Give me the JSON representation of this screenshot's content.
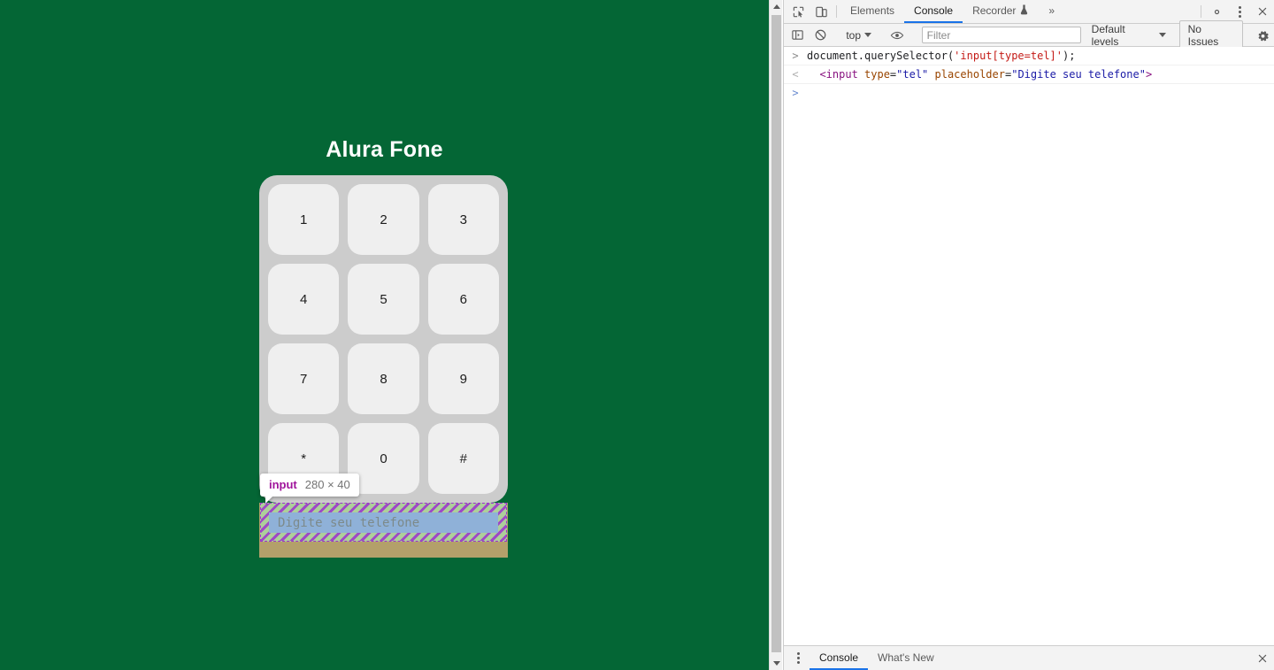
{
  "page": {
    "background_color": "#046635",
    "title": "Alura Fone",
    "keypad": {
      "keys": [
        "1",
        "2",
        "3",
        "4",
        "5",
        "6",
        "7",
        "8",
        "9",
        "*",
        "0",
        "#"
      ],
      "container_color": "#cccccc",
      "key_color": "#efefef"
    },
    "phone_input": {
      "placeholder": "Digite seu telefone",
      "value": ""
    },
    "scrollbar": {
      "up_arrow": "scroll-up",
      "down_arrow": "scroll-down"
    }
  },
  "inspector_tooltip": {
    "tag": "input",
    "dimensions": "280 × 40",
    "tag_color": "#a0149b",
    "dimensions_color": "#737373"
  },
  "devtools": {
    "tabs": [
      {
        "label": "Elements",
        "active": false
      },
      {
        "label": "Console",
        "active": true
      },
      {
        "label": "Recorder",
        "active": false,
        "badge": "experiment-flask-icon"
      }
    ],
    "more_tabs_label": "»",
    "icons": {
      "inspect": "inspect-element-icon",
      "device_toolbar": "device-toolbar-icon",
      "settings": "gear-icon",
      "more_options": "kebab-menu-icon",
      "close": "close-icon"
    },
    "console_toolbar": {
      "sidebar_toggle": "console-sidebar-icon",
      "clear_console": "clear-console-icon",
      "context": "top",
      "live_expression": "eye-icon",
      "filter_placeholder": "Filter",
      "filter_value": "",
      "levels": "Default levels",
      "issues": "No Issues",
      "settings": "gear-icon"
    },
    "console_entries": [
      {
        "gutter": ">",
        "type": "input",
        "tokens": [
          {
            "text": "document.querySelector(",
            "cls": "tok-plain"
          },
          {
            "text": "'input[type=tel]'",
            "cls": "tok-str"
          },
          {
            "text": ");",
            "cls": "tok-plain"
          }
        ]
      },
      {
        "gutter": "<",
        "type": "output",
        "tokens": [
          {
            "text": "  <input",
            "cls": "tok-tag"
          },
          {
            "text": " type",
            "cls": "tok-attr"
          },
          {
            "text": "=",
            "cls": "tok-punct"
          },
          {
            "text": "\"tel\"",
            "cls": "tok-val"
          },
          {
            "text": " placeholder",
            "cls": "tok-attr"
          },
          {
            "text": "=",
            "cls": "tok-punct"
          },
          {
            "text": "\"Digite seu telefone\"",
            "cls": "tok-val"
          },
          {
            "text": ">",
            "cls": "tok-tag"
          }
        ]
      }
    ],
    "prompt_gutter": ">",
    "prompt_value": "",
    "drawer": {
      "menu": "kebab-menu-icon",
      "tabs": [
        {
          "label": "Console",
          "active": true
        },
        {
          "label": "What's New",
          "active": false
        }
      ],
      "close": "close-icon"
    }
  }
}
